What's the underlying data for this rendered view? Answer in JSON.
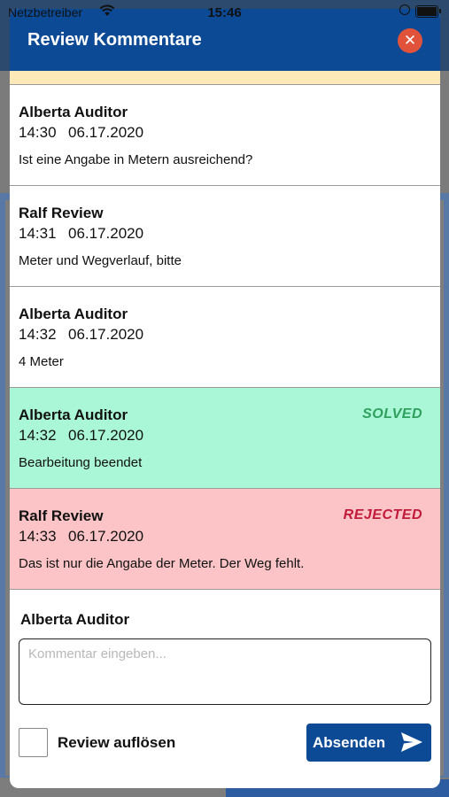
{
  "status_bar": {
    "carrier": "Netzbetreiber",
    "time": "15:46",
    "icons": [
      "wifi-icon",
      "orientation-lock-icon",
      "battery-icon"
    ]
  },
  "modal": {
    "title": "Review Kommentare",
    "close_icon": "close-icon",
    "colors": {
      "header": "#0d4a96",
      "close_button": "#e0533a",
      "solved_bg": "#aaf7d7",
      "solved_text": "#2fa05d",
      "rejected_bg": "#fcc4c6",
      "rejected_text": "#c21a3a",
      "partial_item_bg": "#fde9b7"
    }
  },
  "comments": [
    {
      "author": "Alberta Auditor",
      "time": "14:30",
      "date": "06.17.2020",
      "text": "Ist eine Angabe in Metern ausreichend?",
      "status": ""
    },
    {
      "author": "Ralf Review",
      "time": "14:31",
      "date": "06.17.2020",
      "text": "Meter und Wegverlauf, bitte",
      "status": ""
    },
    {
      "author": "Alberta Auditor",
      "time": "14:32",
      "date": "06.17.2020",
      "text": "4 Meter",
      "status": ""
    },
    {
      "author": "Alberta Auditor",
      "time": "14:32",
      "date": "06.17.2020",
      "text": "Bearbeitung beendet",
      "status": "SOLVED"
    },
    {
      "author": "Ralf Review",
      "time": "14:33",
      "date": "06.17.2020",
      "text": "Das ist nur die Angabe der Meter. Der Weg fehlt.",
      "status": "REJECTED"
    }
  ],
  "compose": {
    "author": "Alberta Auditor",
    "value": "",
    "placeholder": "Kommentar eingeben...",
    "resolve_label": "Review auflösen",
    "resolve_checked": false,
    "send_label": "Absenden",
    "send_icon": "send-icon"
  }
}
